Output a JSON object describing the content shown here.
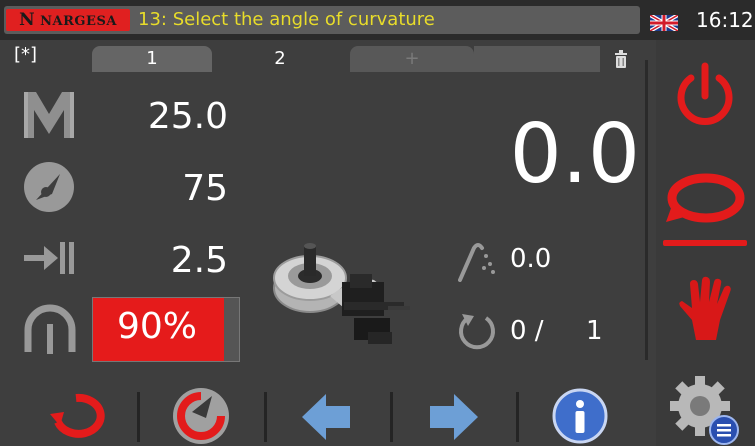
{
  "header": {
    "logo_text": "NARGESA",
    "logo_initial": "N",
    "message": "13: Select the angle of curvature",
    "time": "16:12",
    "language_flag": "uk-flag-icon"
  },
  "tabs": {
    "mode_indicator": "[*]",
    "items": [
      {
        "label": "1",
        "active": false
      },
      {
        "label": "2",
        "active": true
      }
    ],
    "add_label": "+"
  },
  "parameters": {
    "length": "25.0",
    "speed": "75",
    "distance": "2.5",
    "pressure": "90%",
    "pressure_fraction": 0.9
  },
  "readout": {
    "current_angle": "0.0",
    "target_angle": "0.0",
    "count": "0 /",
    "total": "1"
  },
  "colors": {
    "accent_red": "#e31b1b",
    "message_yellow": "#e8dc2a",
    "icon_grey": "#9a9a9a",
    "arrow_blue": "#6d9fd6"
  },
  "icons": {
    "sidebar": [
      "power-icon",
      "bend-cycle-icon",
      "manual-hand-icon",
      "settings-icon"
    ],
    "params": [
      "material-m-icon",
      "speed-gauge-icon",
      "distance-icon",
      "pressure-icon"
    ],
    "bottom": [
      "reverse-cycle-icon",
      "reset-icon",
      "arrow-left-icon",
      "arrow-right-icon",
      "info-icon"
    ]
  }
}
